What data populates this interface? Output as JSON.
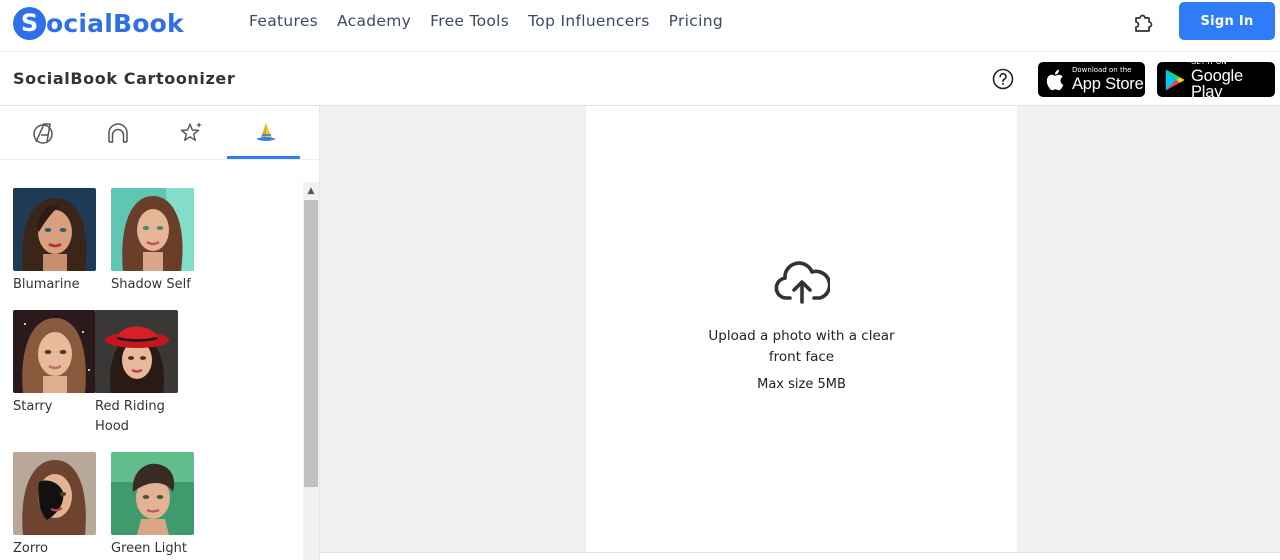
{
  "brand": {
    "logo_letter": "S",
    "logo_rest": "ocialBook"
  },
  "nav": {
    "links": [
      "Features",
      "Academy",
      "Free Tools",
      "Top Influencers",
      "Pricing"
    ],
    "sign_in": "Sign In"
  },
  "subheader": {
    "title": "SocialBook Cartoonizer",
    "app_store": {
      "small": "Download on the",
      "big": "App Store"
    },
    "google_play": {
      "small": "GET IT ON",
      "big": "Google Play"
    }
  },
  "sidebar": {
    "tabs": [
      "avengers-icon",
      "helmet-icon",
      "sparkle-star-icon",
      "witch-hat-icon"
    ],
    "active_tab": 3,
    "styles": [
      {
        "label": "Blumarine"
      },
      {
        "label": "Shadow Self"
      },
      {
        "label": "Starry"
      },
      {
        "label": "Red Riding Hood"
      },
      {
        "label": "Zorro"
      },
      {
        "label": "Green Light"
      }
    ]
  },
  "upload": {
    "text": "Upload a photo with a clear front face",
    "max_size": "Max size 5MB"
  },
  "colors": {
    "accent": "#2f7cf6",
    "brand": "#2f6fe8",
    "panel_bg": "#f0f1f3"
  }
}
